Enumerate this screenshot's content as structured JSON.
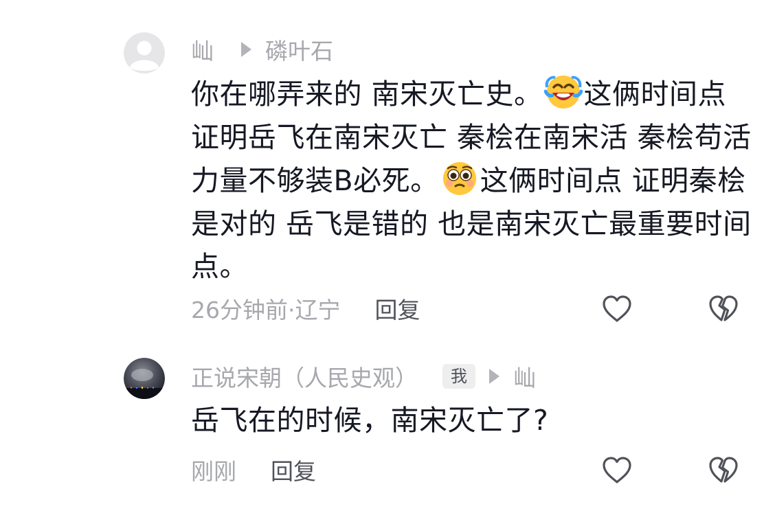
{
  "comments": [
    {
      "author": "屾",
      "reply_to": "磷叶石",
      "text_parts": [
        "你在哪弄来的 南宋灭亡史。",
        "这俩时间点 证明岳飞在南宋灭亡 秦桧在南宋活 秦桧苟活 力量不够装B必死。",
        "这俩时间点 证明秦桧是对的 岳飞是错的 也是南宋灭亡最重要时间点。"
      ],
      "emojis": [
        "laughing-crying-emoji",
        "flushed-pleading-emoji"
      ],
      "time_location": "26分钟前·辽宁",
      "reply_label": "回复"
    },
    {
      "author": "正说宋朝（人民史观）",
      "badge": "我",
      "reply_to": "屾",
      "text": "岳飞在的时候，南宋灭亡了?",
      "time_location": "刚刚",
      "reply_label": "回复"
    }
  ],
  "colors": {
    "primary_text": "#161823",
    "secondary_text": "#a7a8ad",
    "reply_text": "#505259",
    "icon_stroke": "#505259",
    "background": "#ffffff"
  },
  "icons": [
    "default-avatar-icon",
    "play-arrow-icon",
    "heart-outline-icon",
    "broken-heart-icon"
  ]
}
